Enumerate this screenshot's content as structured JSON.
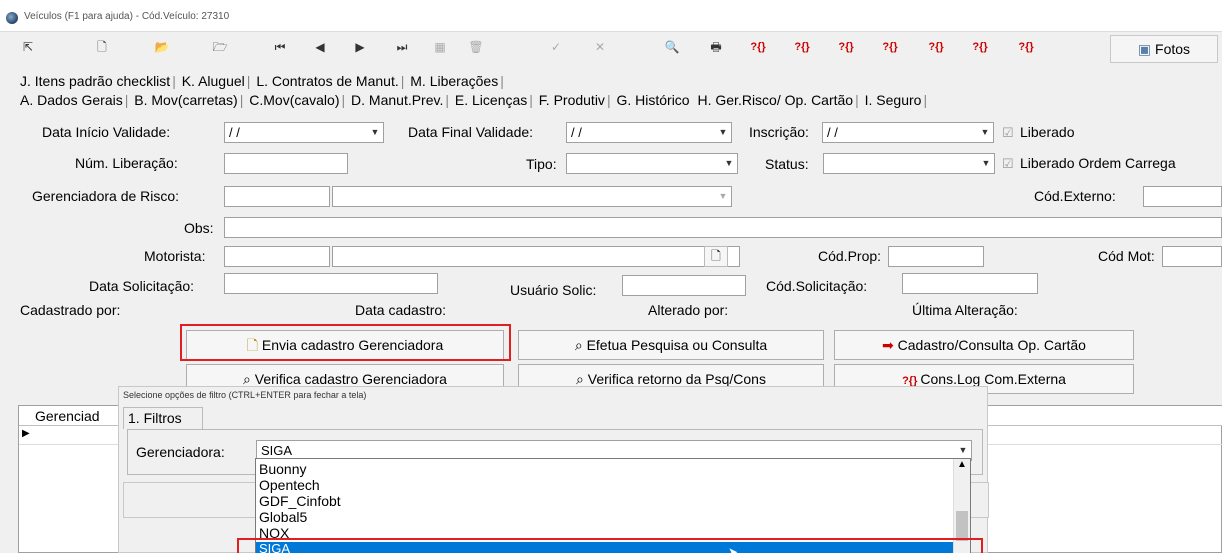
{
  "window": {
    "title": "Veículos (F1 para ajuda) - Cód.Veículo: 27310"
  },
  "toolbar": {
    "fotos_label": "Fotos",
    "log_icons": [
      "?{}",
      "?{}",
      "?{}",
      "?{}",
      "?{}",
      "?{}",
      "?{}"
    ]
  },
  "tabs": {
    "row1": [
      {
        "key": "J",
        "label": "J. Itens padrão checklist"
      },
      {
        "key": "K",
        "label": "K. Aluguel"
      },
      {
        "key": "L",
        "label": "L. Contratos de Manut."
      },
      {
        "key": "M",
        "label": "M. Liberações"
      }
    ],
    "row2": [
      {
        "label": "A. Dados Gerais"
      },
      {
        "label": "B. Mov(carretas)"
      },
      {
        "label": "C.Mov(cavalo)"
      },
      {
        "label": "D. Manut.Prev."
      },
      {
        "label": "E. Licenças"
      },
      {
        "label": "F. Produtiv"
      },
      {
        "label": "G. Histórico"
      },
      {
        "label": "H. Ger.Risco/ Op. Cartão",
        "active": true
      },
      {
        "label": "I. Seguro"
      }
    ]
  },
  "form": {
    "data_inicio_label": "Data Início Validade:",
    "data_inicio_value": " / /",
    "data_final_label": "Data Final Validade:",
    "data_final_value": " / /",
    "inscricao_label": "Inscrição:",
    "inscricao_value": " / /",
    "liberado_label": "Liberado",
    "num_liberacao_label": "Núm. Liberação:",
    "tipo_label": "Tipo:",
    "status_label": "Status:",
    "liberado_ordem_label": "Liberado Ordem Carrega",
    "gerenciadora_label": "Gerenciadora de Risco:",
    "cod_externo_label": "Cód.Externo:",
    "obs_label": "Obs:",
    "motorista_label": "Motorista:",
    "cod_prop_label": "Cód.Prop:",
    "cod_mot_label": "Cód Mot:",
    "data_solicitacao_label": "Data Solicitação:",
    "usuario_solic_label": "Usuário Solic:",
    "cod_solicitacao_label": "Cód.Solicitação:",
    "cadastrado_por_label": "Cadastrado por:",
    "data_cadastro_label": "Data cadastro:",
    "alterado_por_label": "Alterado por:",
    "ultima_alteracao_label": "Última Alteração:"
  },
  "buttons": {
    "envia": "Envia cadastro Gerenciadora",
    "efetua": "Efetua Pesquisa ou Consulta",
    "cadastro_op": "Cadastro/Consulta Op. Cartão",
    "verifica_cad": "Verifica cadastro Gerenciadora",
    "verifica_ret": "Verifica retorno da Psq/Cons",
    "cons_log": "Cons.Log Com.Externa"
  },
  "grid": {
    "column": "Gerenciad"
  },
  "filter_panel": {
    "hint": "Selecione opções de filtro (CTRL+ENTER para fechar a tela)",
    "tab": "1. Filtros",
    "gerenciadora_label": "Gerenciadora:",
    "selected": "SIGA",
    "options": [
      "Buonny",
      "Opentech",
      "GDF_Cinfobt",
      "Global5",
      "NOX",
      "SIGA"
    ]
  },
  "colors": {
    "highlight_border": "#e02020",
    "selection": "#0078d7"
  }
}
